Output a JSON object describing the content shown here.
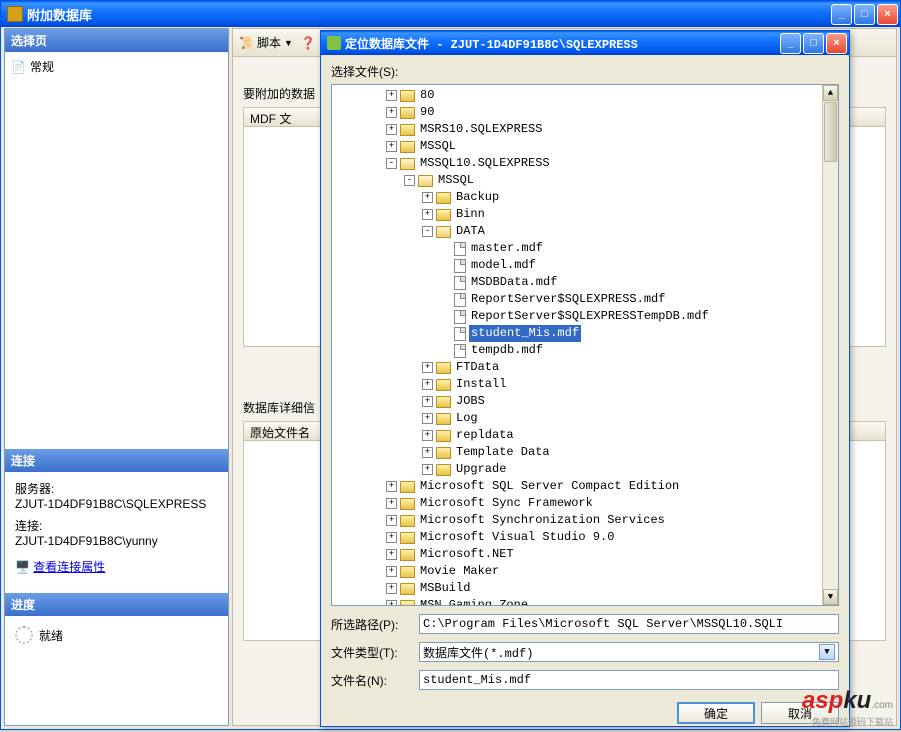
{
  "main": {
    "title": "附加数据库"
  },
  "left": {
    "select_page": "选择页",
    "general": "常规",
    "connection_header": "连接",
    "server_label": "服务器:",
    "server_value": "ZJUT-1D4DF91B8C\\SQLEXPRESS",
    "connection_label": "连接:",
    "connection_value": "ZJUT-1D4DF91B8C\\yunny",
    "view_props": "查看连接属性",
    "progress_header": "进度",
    "ready": "就绪"
  },
  "right": {
    "script_btn": "脚本",
    "attach_label": "要附加的数据",
    "mdf_col": "MDF 文",
    "detail_label": "数据库详细信",
    "orig_col": "原始文件名"
  },
  "modal": {
    "title": "定位数据库文件 - ZJUT-1D4DF91B8C\\SQLEXPRESS",
    "select_files": "选择文件(S):",
    "path_label": "所选路径(P):",
    "path_value": "C:\\Program Files\\Microsoft SQL Server\\MSSQL10.SQLI",
    "type_label": "文件类型(T):",
    "type_value": "数据库文件(*.mdf)",
    "name_label": "文件名(N):",
    "name_value": "student_Mis.mdf",
    "ok": "确定",
    "cancel": "取消"
  },
  "tree": [
    {
      "depth": 3,
      "exp": "+",
      "icon": "folder",
      "label": "80"
    },
    {
      "depth": 3,
      "exp": "+",
      "icon": "folder",
      "label": "90"
    },
    {
      "depth": 3,
      "exp": "+",
      "icon": "folder",
      "label": "MSRS10.SQLEXPRESS"
    },
    {
      "depth": 3,
      "exp": "+",
      "icon": "folder",
      "label": "MSSQL"
    },
    {
      "depth": 3,
      "exp": "-",
      "icon": "folder-open",
      "label": "MSSQL10.SQLEXPRESS"
    },
    {
      "depth": 4,
      "exp": "-",
      "icon": "folder-open",
      "label": "MSSQL"
    },
    {
      "depth": 5,
      "exp": "+",
      "icon": "folder",
      "label": "Backup"
    },
    {
      "depth": 5,
      "exp": "+",
      "icon": "folder",
      "label": "Binn"
    },
    {
      "depth": 5,
      "exp": "-",
      "icon": "folder-open",
      "label": "DATA"
    },
    {
      "depth": 6,
      "exp": " ",
      "icon": "file",
      "label": "master.mdf"
    },
    {
      "depth": 6,
      "exp": " ",
      "icon": "file",
      "label": "model.mdf"
    },
    {
      "depth": 6,
      "exp": " ",
      "icon": "file",
      "label": "MSDBData.mdf"
    },
    {
      "depth": 6,
      "exp": " ",
      "icon": "file",
      "label": "ReportServer$SQLEXPRESS.mdf"
    },
    {
      "depth": 6,
      "exp": " ",
      "icon": "file",
      "label": "ReportServer$SQLEXPRESSTempDB.mdf"
    },
    {
      "depth": 6,
      "exp": " ",
      "icon": "file",
      "label": "student_Mis.mdf",
      "selected": true
    },
    {
      "depth": 6,
      "exp": " ",
      "icon": "file",
      "label": "tempdb.mdf"
    },
    {
      "depth": 5,
      "exp": "+",
      "icon": "folder",
      "label": "FTData"
    },
    {
      "depth": 5,
      "exp": "+",
      "icon": "folder",
      "label": "Install"
    },
    {
      "depth": 5,
      "exp": "+",
      "icon": "folder",
      "label": "JOBS"
    },
    {
      "depth": 5,
      "exp": "+",
      "icon": "folder",
      "label": "Log"
    },
    {
      "depth": 5,
      "exp": "+",
      "icon": "folder",
      "label": "repldata"
    },
    {
      "depth": 5,
      "exp": "+",
      "icon": "folder",
      "label": "Template Data"
    },
    {
      "depth": 5,
      "exp": "+",
      "icon": "folder",
      "label": "Upgrade"
    },
    {
      "depth": 3,
      "exp": "+",
      "icon": "folder",
      "label": "Microsoft SQL Server Compact Edition"
    },
    {
      "depth": 3,
      "exp": "+",
      "icon": "folder",
      "label": "Microsoft Sync Framework"
    },
    {
      "depth": 3,
      "exp": "+",
      "icon": "folder",
      "label": "Microsoft Synchronization Services"
    },
    {
      "depth": 3,
      "exp": "+",
      "icon": "folder",
      "label": "Microsoft Visual Studio 9.0"
    },
    {
      "depth": 3,
      "exp": "+",
      "icon": "folder",
      "label": "Microsoft.NET"
    },
    {
      "depth": 3,
      "exp": "+",
      "icon": "folder",
      "label": "Movie Maker"
    },
    {
      "depth": 3,
      "exp": "+",
      "icon": "folder",
      "label": "MSBuild"
    },
    {
      "depth": 3,
      "exp": "+",
      "icon": "folder",
      "label": "MSN Gaming Zone"
    }
  ],
  "wm": {
    "a": "asp",
    "b": "ku",
    "c": ".com",
    "d": "免费网站源码下载站"
  }
}
